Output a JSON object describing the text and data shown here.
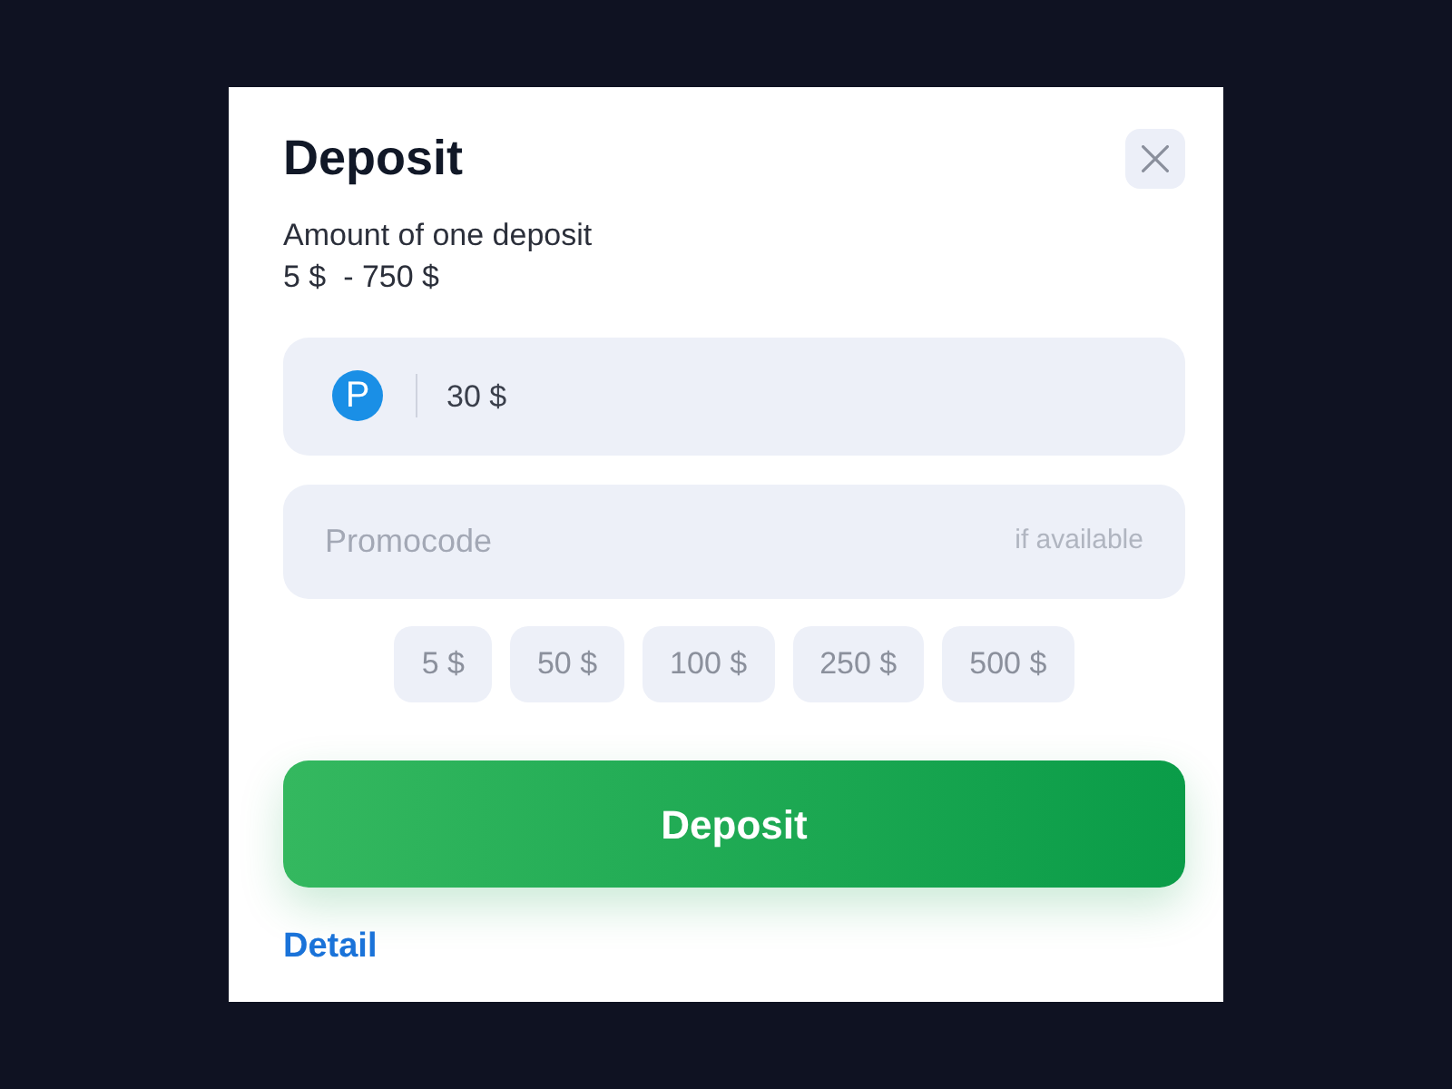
{
  "dialog": {
    "title": "Deposit",
    "limits_label": "Amount of one deposit",
    "limits": "5 $  - 750 $"
  },
  "amount_field": {
    "method_logo": "P",
    "value": "30 $"
  },
  "promocode_field": {
    "placeholder": "Promocode",
    "hint": "if available"
  },
  "quick_amounts": [
    "5 $",
    "50 $",
    "100 $",
    "250 $",
    "500 $"
  ],
  "submit_button": "Deposit",
  "detail_link": "Detail"
}
